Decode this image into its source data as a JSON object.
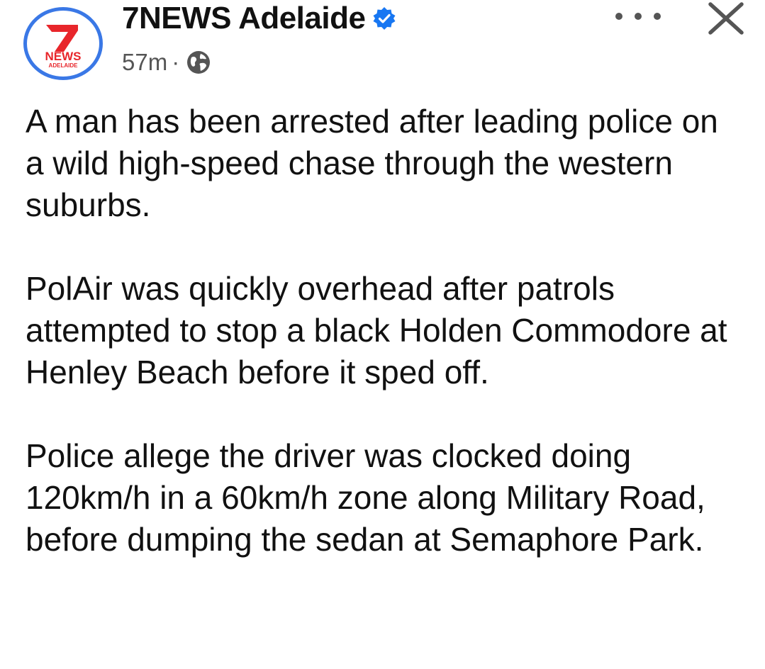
{
  "post": {
    "page_name": "7NEWS Adelaide",
    "timestamp": "57m",
    "separator": "·",
    "verified_icon": "verified-badge-icon",
    "audience_icon": "globe-icon",
    "avatar": {
      "logo_number": "7",
      "logo_word": "NEWS",
      "logo_city": "ADELAIDE"
    },
    "paragraphs": [
      "A man has been arrested after leading police on a wild high-speed chase through the western suburbs.",
      "PolAir was quickly overhead after patrols attempted to stop a black Holden Commodore at Henley Beach before it sped off.",
      "Police allege the driver was clocked doing 120km/h in a 60km/h zone along Military Road, before dumping the sedan at Semaphore Park."
    ]
  },
  "controls": {
    "more_icon": "more-options-icon",
    "close_icon": "close-icon"
  },
  "colors": {
    "verified_blue": "#1877f2",
    "avatar_ring": "#3a78e6",
    "logo_red": "#e8262b",
    "text": "#111111",
    "secondary_text": "#555555"
  }
}
